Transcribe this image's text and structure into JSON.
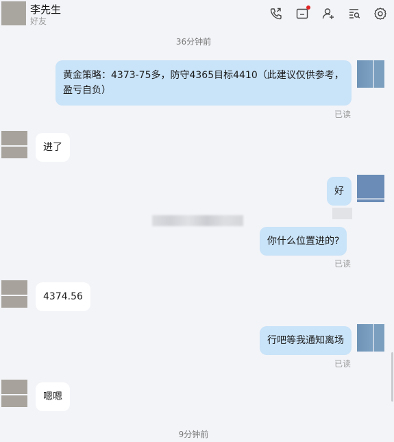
{
  "contact": {
    "name": "李先生",
    "subtitle": "好友"
  },
  "header_icons": [
    "call-icon",
    "file-icon",
    "add-friend-icon",
    "search-history-icon",
    "settings-icon"
  ],
  "colors": {
    "outgoing_bubble": "#c9e3f8",
    "incoming_bubble": "#ffffff",
    "notification_dot": "#e02424",
    "background": "#f3f4f8"
  },
  "timestamps": {
    "top": "36分钟前",
    "bottom": "9分钟前"
  },
  "messages": [
    {
      "from": "me",
      "lines": [
        "黄金策略：4373-75多，防守4365目标4410（此建议仅供参考，",
        "盈亏自负）"
      ],
      "status": "已读"
    },
    {
      "from": "them",
      "text": "进了"
    },
    {
      "from": "me",
      "text": "好"
    },
    {
      "from": "me",
      "text": "你什么位置进的?",
      "status": "已读"
    },
    {
      "from": "them",
      "text": "4374.56"
    },
    {
      "from": "me",
      "text": "行吧等我通知离场",
      "status": "已读"
    },
    {
      "from": "them",
      "text": "嗯嗯"
    }
  ]
}
